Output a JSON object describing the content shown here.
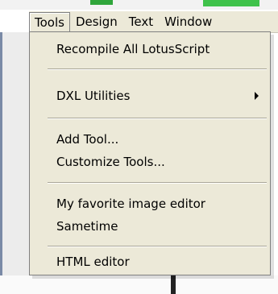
{
  "menubar": {
    "items": [
      {
        "label": "Tools"
      },
      {
        "label": "Design"
      },
      {
        "label": "Text"
      },
      {
        "label": "Window"
      }
    ]
  },
  "menu": {
    "recompile": "Recompile All LotusScript",
    "dxl": "DXL Utilities",
    "add_tool": "Add Tool...",
    "customize_tools": "Customize Tools...",
    "image_editor": "My favorite image editor",
    "sametime": "Sametime",
    "html_editor": "HTML editor"
  }
}
